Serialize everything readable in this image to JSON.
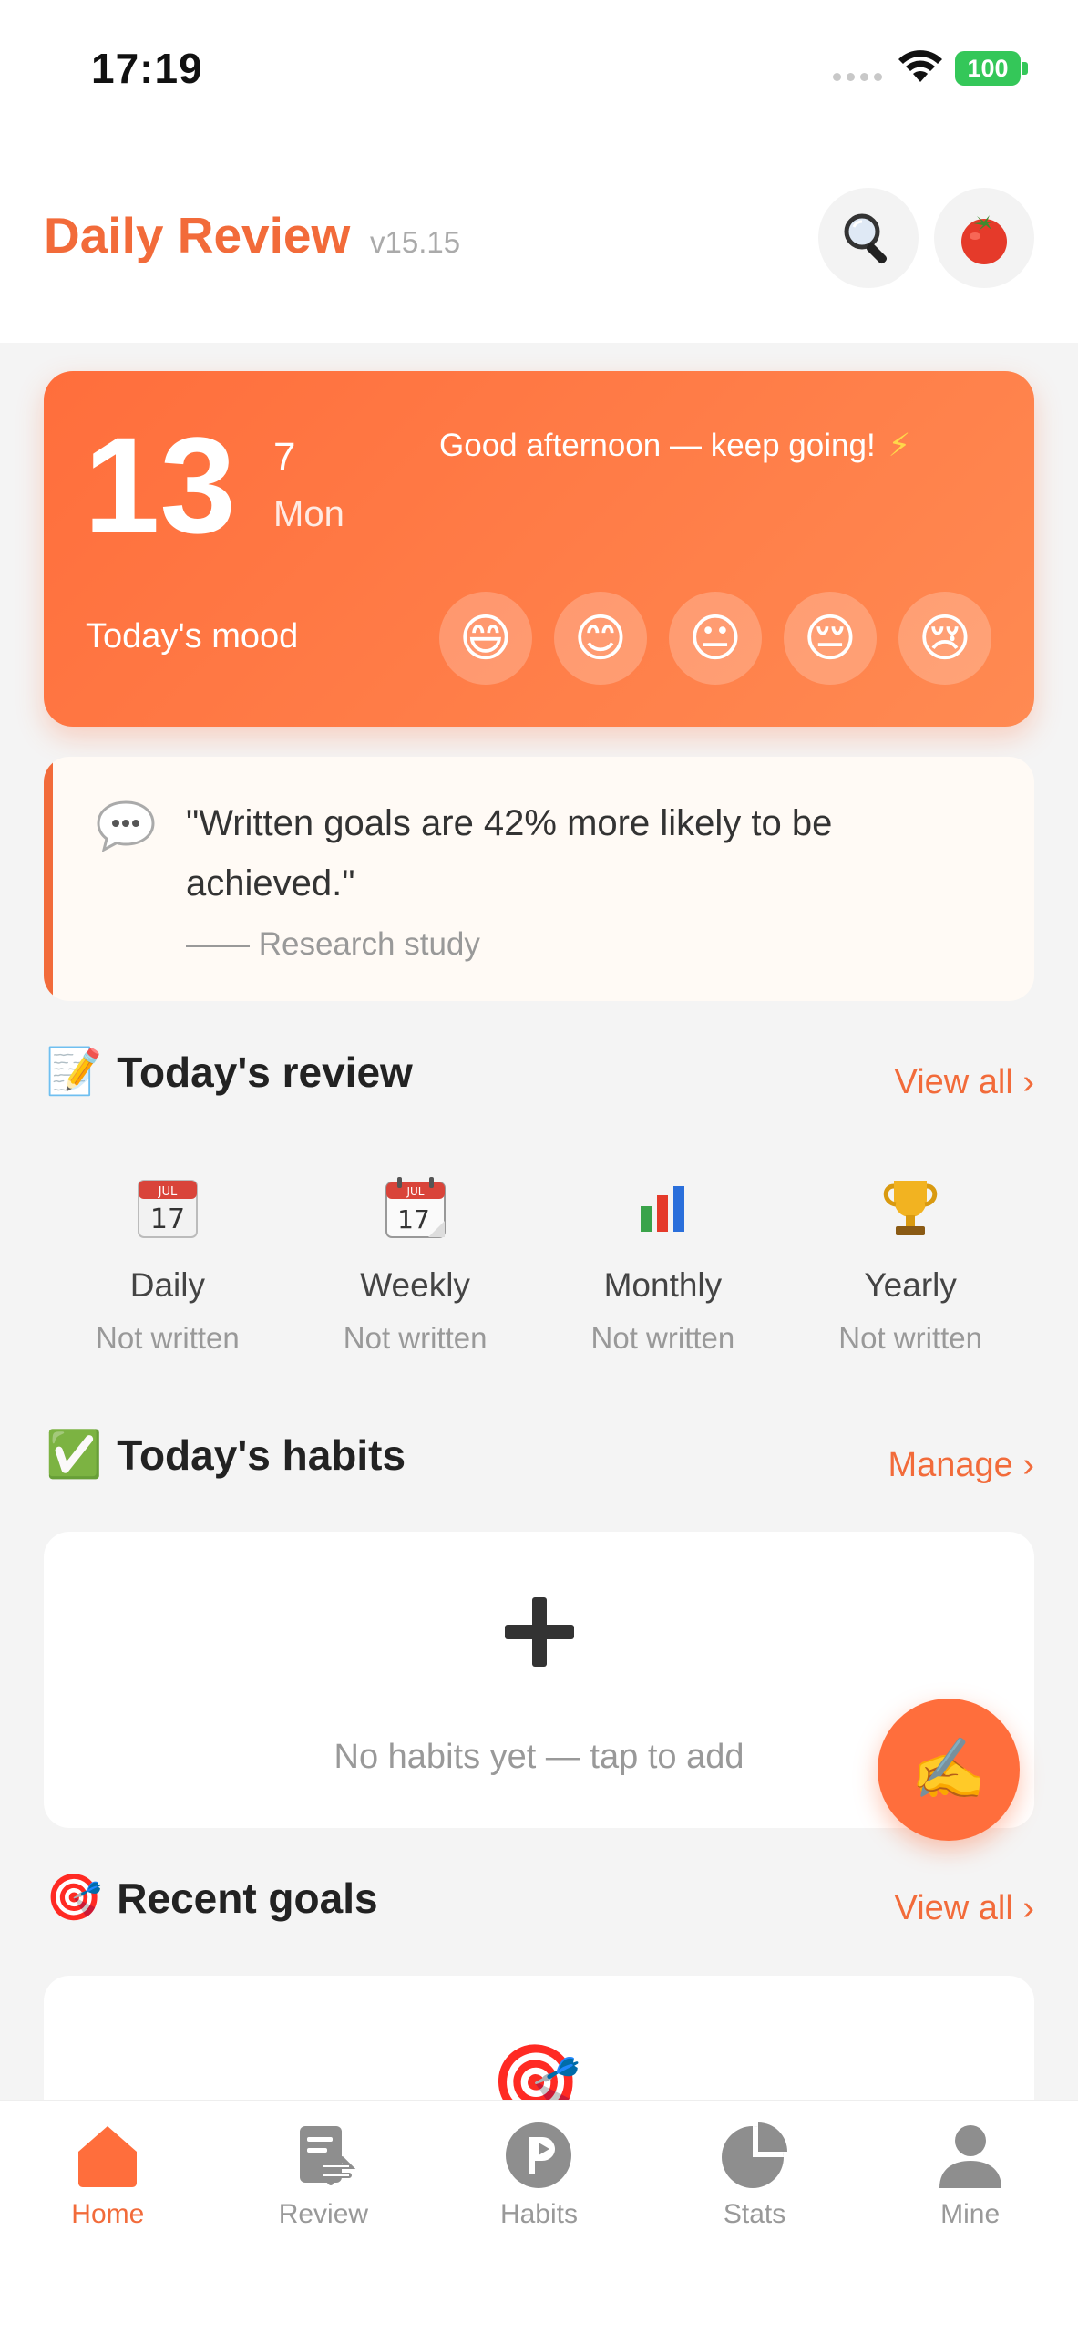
{
  "status_bar": {
    "time": "17:19",
    "battery": "100"
  },
  "header": {
    "title": "Daily Review",
    "version": "v15.15",
    "search_icon": "magnifier-icon",
    "focus_icon": "tomato-icon"
  },
  "date_card": {
    "day": "13",
    "month": "7",
    "weekday": "Mon",
    "greeting": "Good afternoon — keep going!",
    "greeting_emoji": "⚡",
    "mood_label": "Today's mood",
    "moods": [
      "😄",
      "😊",
      "😐",
      "😔",
      "😢"
    ]
  },
  "quote": {
    "icon": "speech-bubble-icon",
    "text": "\"Written goals are 42% more likely to be achieved.\"",
    "source": "—— Research study"
  },
  "review_section": {
    "emoji": "📝",
    "title": "Today's review",
    "link": "View all ›",
    "items": [
      {
        "label": "Daily",
        "status": "Not written"
      },
      {
        "label": "Weekly",
        "status": "Not written"
      },
      {
        "label": "Monthly",
        "status": "Not written"
      },
      {
        "label": "Yearly",
        "status": "Not written"
      }
    ]
  },
  "habits_section": {
    "emoji": "✅",
    "title": "Today's habits",
    "link": "Manage ›",
    "empty": "No habits yet — tap to add"
  },
  "fab": {
    "emoji": "✍️"
  },
  "goals_section": {
    "emoji": "🎯",
    "title": "Recent goals",
    "link": "View all ›"
  },
  "tabs": [
    {
      "label": "Home",
      "active": true
    },
    {
      "label": "Review",
      "active": false
    },
    {
      "label": "Habits",
      "active": false
    },
    {
      "label": "Stats",
      "active": false
    },
    {
      "label": "Mine",
      "active": false
    }
  ],
  "colors": {
    "accent": "#f26b3a",
    "card_gradient_start": "#ff6e3c",
    "card_gradient_end": "#ff8a52",
    "muted": "#999999"
  }
}
